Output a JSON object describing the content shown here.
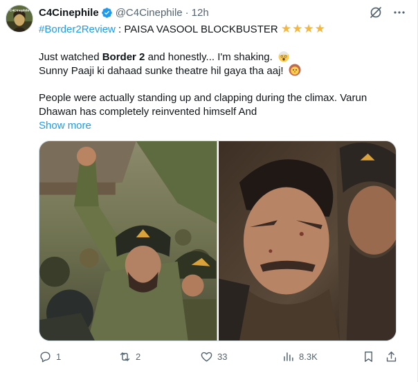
{
  "tweet": {
    "display_name": "C4Cinephile",
    "handle": "@C4Cinephile",
    "separator": "·",
    "time": "12h",
    "avatar_text": "C4Cinephile",
    "hashtag": "#Border2Review",
    "headline_rest": " : PAISA VASOOL BLOCKBUSTER",
    "stars": "★★★★",
    "line2_pre": "Just watched ",
    "line2_bold": "Border 2",
    "line2_post": " and honestly... I'm shaking.",
    "line3": "Sunny Paaji ki dahaad sunke theatre hil gaya tha aaj!",
    "line4": "People were actually standing up and clapping during the climax. Varun",
    "line5": "Dhawan has completely reinvented himself And",
    "show_more": "Show more"
  },
  "actions": {
    "reply_count": "1",
    "retweet_count": "2",
    "like_count": "33",
    "views_count": "8.3K"
  },
  "colors": {
    "accent": "#1d9bf0",
    "muted": "#536471",
    "star": "#f4b63f"
  },
  "icons": [
    "verified-badge-icon",
    "grok-icon",
    "more-icon",
    "shocked-emoji-icon",
    "lion-emoji-icon",
    "reply-icon",
    "retweet-icon",
    "like-icon",
    "views-icon",
    "bookmark-icon",
    "share-icon"
  ]
}
